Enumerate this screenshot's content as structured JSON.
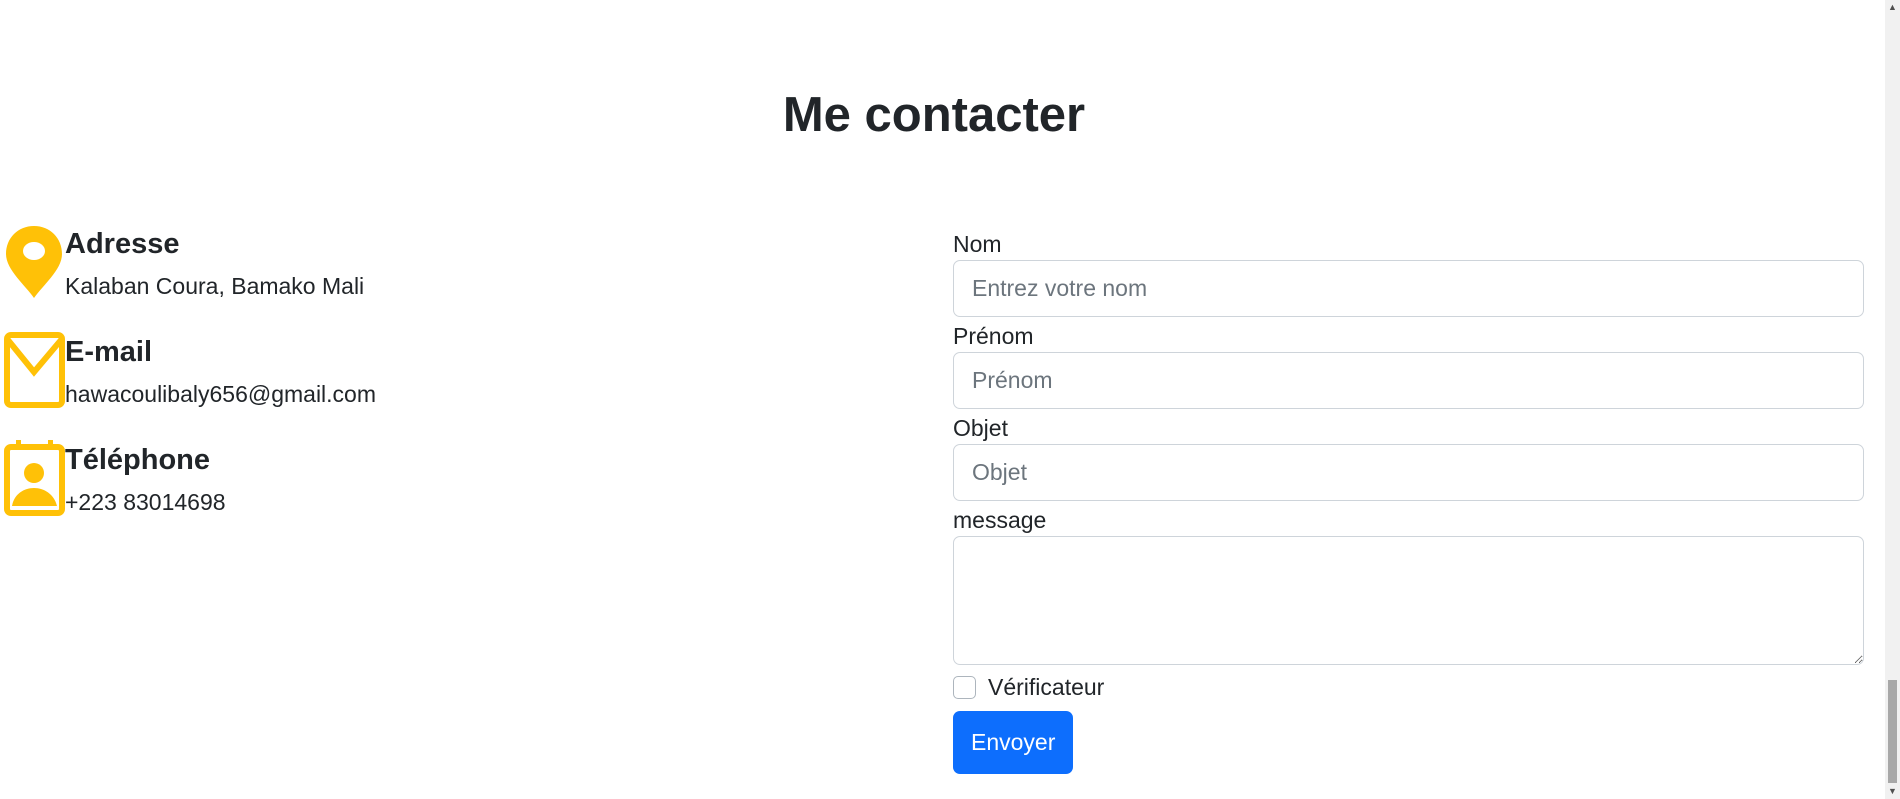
{
  "page": {
    "title": "Me contacter"
  },
  "contact_info": {
    "address": {
      "icon": "location-pin-icon",
      "heading": "Adresse",
      "text": "Kalaban Coura, Bamako Mali"
    },
    "email": {
      "icon": "envelope-icon",
      "heading": "E-mail",
      "text": "hawacoulibaly656@gmail.com"
    },
    "phone": {
      "icon": "contact-card-icon",
      "heading": "Téléphone",
      "text": "+223 83014698"
    },
    "icon_color": "#ffc107"
  },
  "form": {
    "nom": {
      "label": "Nom",
      "placeholder": "Entrez votre nom",
      "value": ""
    },
    "prenom": {
      "label": "Prénom",
      "placeholder": "Prénom",
      "value": ""
    },
    "objet": {
      "label": "Objet",
      "placeholder": "Objet",
      "value": ""
    },
    "message": {
      "label": "message",
      "value": ""
    },
    "checkbox": {
      "label": "Vérificateur",
      "checked": false
    },
    "submit_label": "Envoyer",
    "button_color": "#0d6efd"
  }
}
